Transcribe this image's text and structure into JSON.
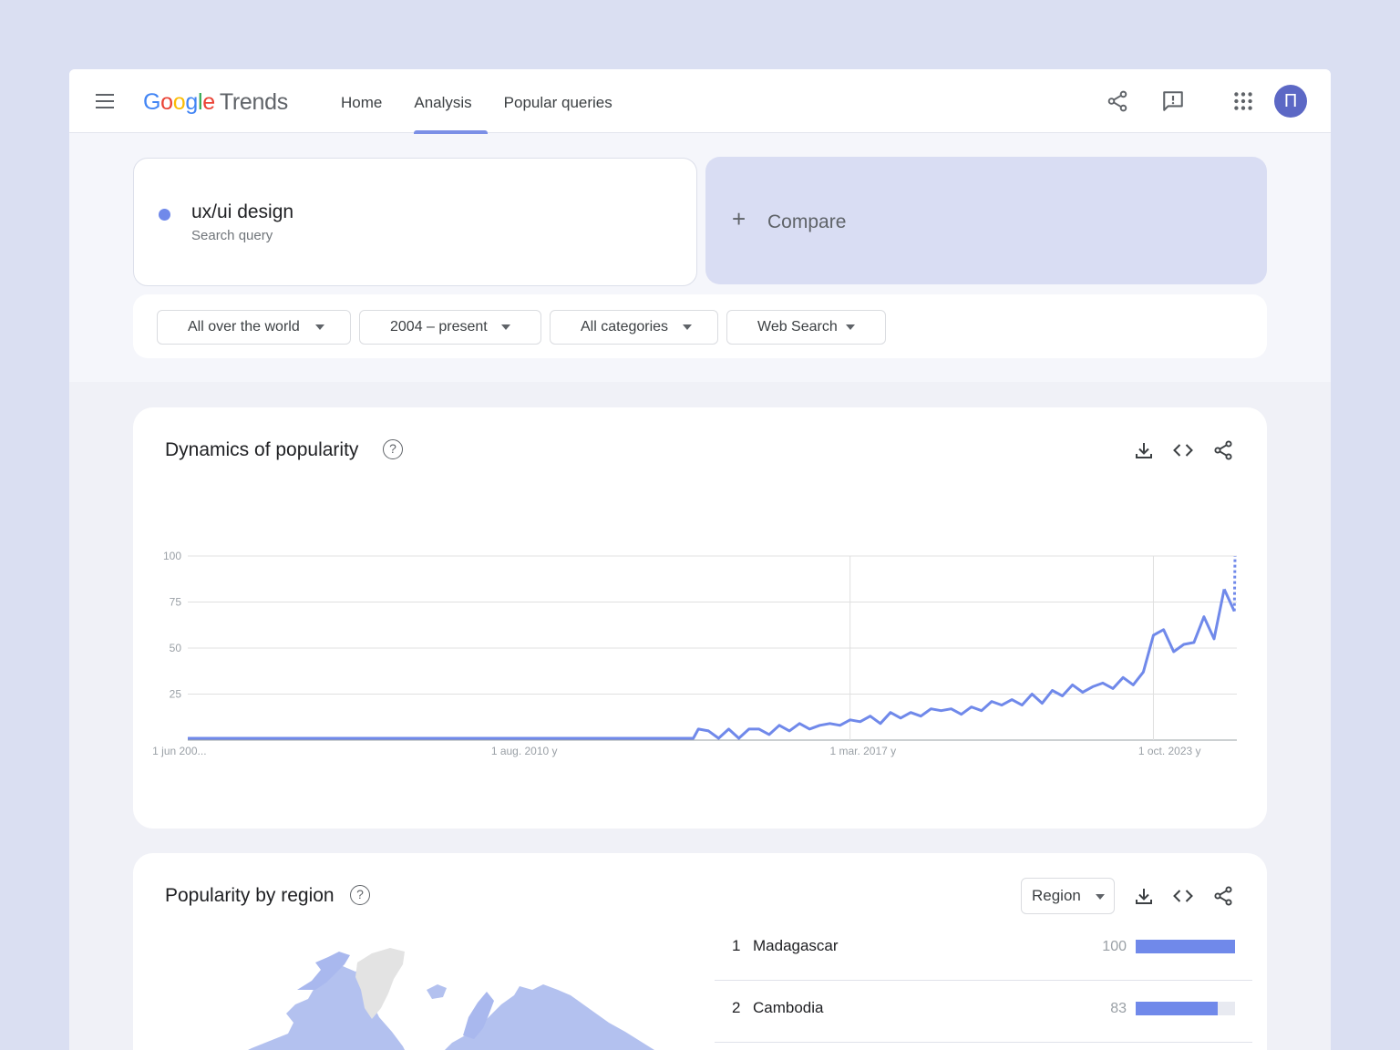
{
  "header": {
    "logo_google": "Google",
    "logo_product": "Trends",
    "nav": [
      "Home",
      "Analysis",
      "Popular queries"
    ],
    "active_nav": "Analysis",
    "avatar_letter": "П",
    "icons": [
      "menu-icon",
      "share-icon",
      "feedback-icon",
      "apps-grid-icon"
    ]
  },
  "search": {
    "term": "ux/ui design",
    "term_type": "Search query",
    "term_color": "#7089ea",
    "compare_label": "Compare"
  },
  "filters": {
    "location": "All over the world",
    "time": "2004 – present",
    "category": "All categories",
    "property": "Web Search"
  },
  "chart_section": {
    "title": "Dynamics of popularity",
    "icons": [
      "help-icon",
      "download-icon",
      "embed-code-icon",
      "share-icon"
    ]
  },
  "chart_data": {
    "type": "line",
    "series": [
      {
        "color": "#7089ea",
        "x": [
          2004.0,
          2004.5,
          2005.0,
          2005.5,
          2006.0,
          2006.5,
          2007.0,
          2007.5,
          2008.0,
          2008.5,
          2009.0,
          2009.5,
          2010.0,
          2010.5,
          2011.0,
          2011.5,
          2012.0,
          2012.5,
          2013.0,
          2013.5,
          2014.0,
          2014.1,
          2014.3,
          2014.5,
          2014.7,
          2014.9,
          2015.1,
          2015.3,
          2015.5,
          2015.7,
          2015.9,
          2016.1,
          2016.3,
          2016.5,
          2016.7,
          2016.9,
          2017.1,
          2017.3,
          2017.5,
          2017.7,
          2017.9,
          2018.1,
          2018.3,
          2018.5,
          2018.7,
          2018.9,
          2019.1,
          2019.3,
          2019.5,
          2019.7,
          2019.9,
          2020.1,
          2020.3,
          2020.5,
          2020.7,
          2020.9,
          2021.1,
          2021.3,
          2021.5,
          2021.7,
          2021.9,
          2022.1,
          2022.3,
          2022.5,
          2022.7,
          2022.9,
          2023.1,
          2023.3,
          2023.5,
          2023.7,
          2023.9,
          2024.1,
          2024.3,
          2024.5,
          2024.7
        ],
        "y": [
          1,
          1,
          1,
          1,
          1,
          1,
          1,
          1,
          1,
          1,
          1,
          1,
          1,
          1,
          1,
          1,
          1,
          1,
          1,
          1,
          1,
          6,
          5,
          1,
          6,
          1,
          6,
          6,
          3,
          8,
          5,
          9,
          6,
          8,
          9,
          8,
          11,
          10,
          13,
          9,
          15,
          12,
          15,
          13,
          17,
          16,
          17,
          14,
          18,
          16,
          21,
          19,
          22,
          19,
          25,
          20,
          27,
          24,
          30,
          26,
          29,
          31,
          28,
          34,
          30,
          37,
          57,
          60,
          48,
          52,
          53,
          67,
          55,
          82,
          70
        ]
      }
    ],
    "x_ticks": [
      "1 jun 200...",
      "1 aug. 2010 y",
      "1 mar. 2017 y",
      "1 oct. 2023 y"
    ],
    "y_ticks": [
      100,
      75,
      50,
      25
    ],
    "ylim": [
      0,
      100
    ],
    "grid": true,
    "partial_last_segment": true
  },
  "region_section": {
    "title": "Popularity by region",
    "view_select": "Region",
    "rows": [
      {
        "rank": "1",
        "name": "Madagascar",
        "value": 100
      },
      {
        "rank": "2",
        "name": "Cambodia",
        "value": 83
      }
    ],
    "bar_color": "#7089ea",
    "map_fill": "#b3c1ef",
    "map_nodata": "#e3e3e3"
  }
}
